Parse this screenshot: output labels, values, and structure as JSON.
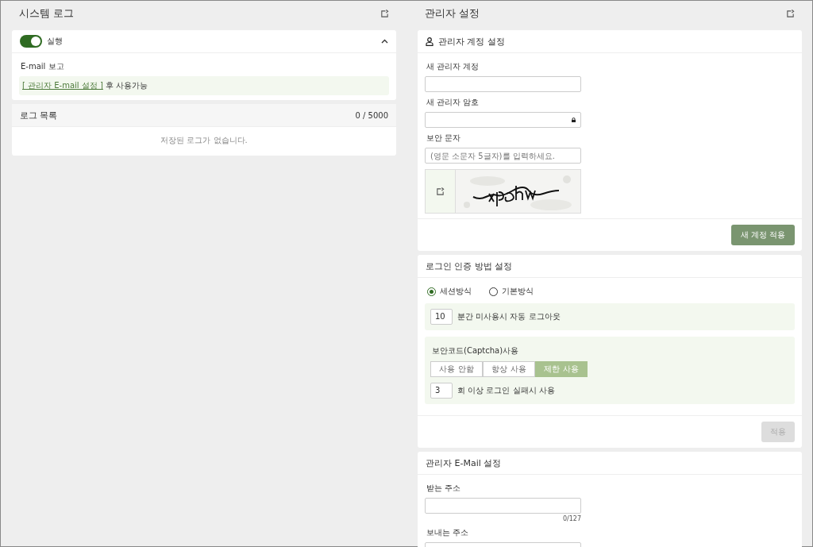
{
  "system_log": {
    "title": "시스템 로그",
    "run_toggle": {
      "label": "실행",
      "on": true,
      "expanded": true
    },
    "email_report": {
      "label": "E-mail 보고",
      "link": "[ 관리자 E-mail 설정 ]",
      "note": "후 사용가능"
    },
    "log_list": {
      "title": "로그 목록",
      "count": "0 / 5000",
      "empty": "저장된 로그가 없습니다."
    }
  },
  "admin_settings": {
    "title": "관리자 설정",
    "account": {
      "title": "관리자 계정 설정",
      "fields": [
        {
          "label": "새 관리자 계정",
          "kind": "text"
        },
        {
          "label": "새 관리자 암호",
          "kind": "password"
        },
        {
          "label": "보안 문자",
          "kind": "text",
          "placeholder": "(영문 소문자 5글자)를 입력하세요."
        }
      ],
      "button": "새 계정 적용"
    },
    "login_auth": {
      "title": "로그인 인증 방법 설정",
      "methods": [
        {
          "label": "세션방식",
          "selected": true
        },
        {
          "label": "기본방식",
          "selected": false
        }
      ],
      "timeout": {
        "value": "10",
        "label": "분간 미사용시 자동 로그아웃"
      },
      "captcha_use": {
        "label": "보안코드(Captcha)사용",
        "options": [
          {
            "label": "사용 안함",
            "selected": false
          },
          {
            "label": "항상 사용",
            "selected": false
          },
          {
            "label": "제한 사용",
            "selected": true
          }
        ],
        "attempts": {
          "value": "3",
          "label": "회 이상 로그인 실패시 사용"
        }
      },
      "button": {
        "label": "적용",
        "disabled": true
      }
    },
    "email": {
      "title": "관리자 E-Mail 설정",
      "fields": [
        {
          "label": "받는 주소",
          "counter": "0/127"
        },
        {
          "label": "보내는 주소"
        }
      ]
    }
  }
}
